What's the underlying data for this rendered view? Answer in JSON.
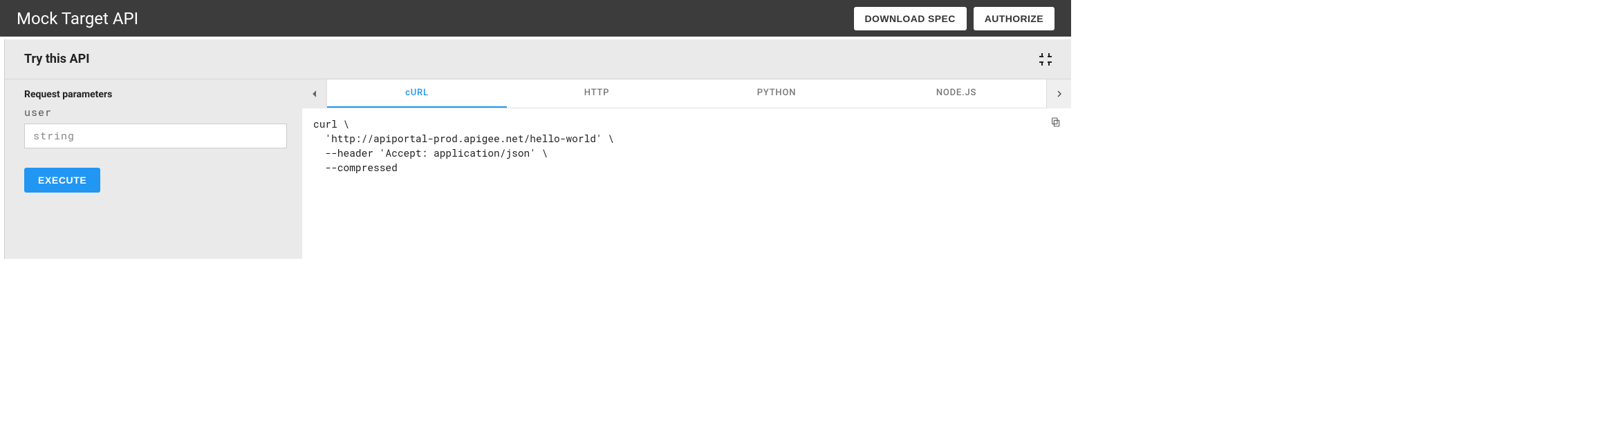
{
  "header": {
    "title": "Mock Target API",
    "download_label": "DOWNLOAD SPEC",
    "authorize_label": "AUTHORIZE"
  },
  "panel": {
    "title": "Try this API"
  },
  "request": {
    "section_label": "Request parameters",
    "params": [
      {
        "name": "user",
        "placeholder": "string",
        "value": ""
      }
    ],
    "execute_label": "EXECUTE"
  },
  "code_tabs": {
    "items": [
      {
        "label": "cURL",
        "active": true
      },
      {
        "label": "HTTP",
        "active": false
      },
      {
        "label": "PYTHON",
        "active": false
      },
      {
        "label": "NODE.JS",
        "active": false
      }
    ],
    "snippet": "curl \\\n  'http://apiportal-prod.apigee.net/hello-world' \\\n  --header 'Accept: application/json' \\\n  --compressed"
  }
}
